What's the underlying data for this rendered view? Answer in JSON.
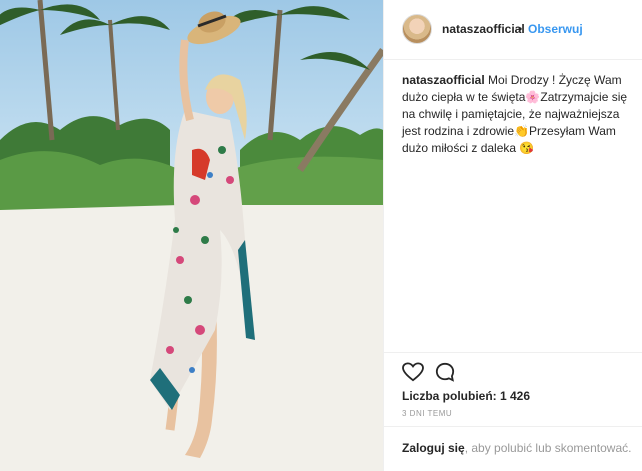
{
  "post": {
    "photo_alt": "Woman in floral kimono on beach holding straw hat",
    "header": {
      "username": "nataszaofficial",
      "separator": "•",
      "follow_label": "Obserwuj"
    },
    "caption": {
      "username": "nataszaofficial",
      "text_part1": " Moi Drodzy ! Życzę Wam dużo ciepła w te święta",
      "emoji1": "🌸",
      "text_part2": "Zatrzymajcie się na chwilę i pamiętajcie, że najważniejsza jest rodzina i zdrowie",
      "emoji2": "👏",
      "text_part3": "Przesyłam Wam dużo miłości z daleka ",
      "emoji3": "😘"
    },
    "actions": {
      "like_icon": "heart-icon",
      "comment_icon": "comment-icon"
    },
    "likes_text": "Liczba polubień: 1 426",
    "time_text": "3 DNI TEMU",
    "login": {
      "link_label": "Zaloguj się",
      "rest": ", aby polubić lub skomentować."
    }
  },
  "colors": {
    "link_blue": "#3897f0",
    "text": "#262626",
    "muted": "#999999",
    "border": "#efefef"
  }
}
